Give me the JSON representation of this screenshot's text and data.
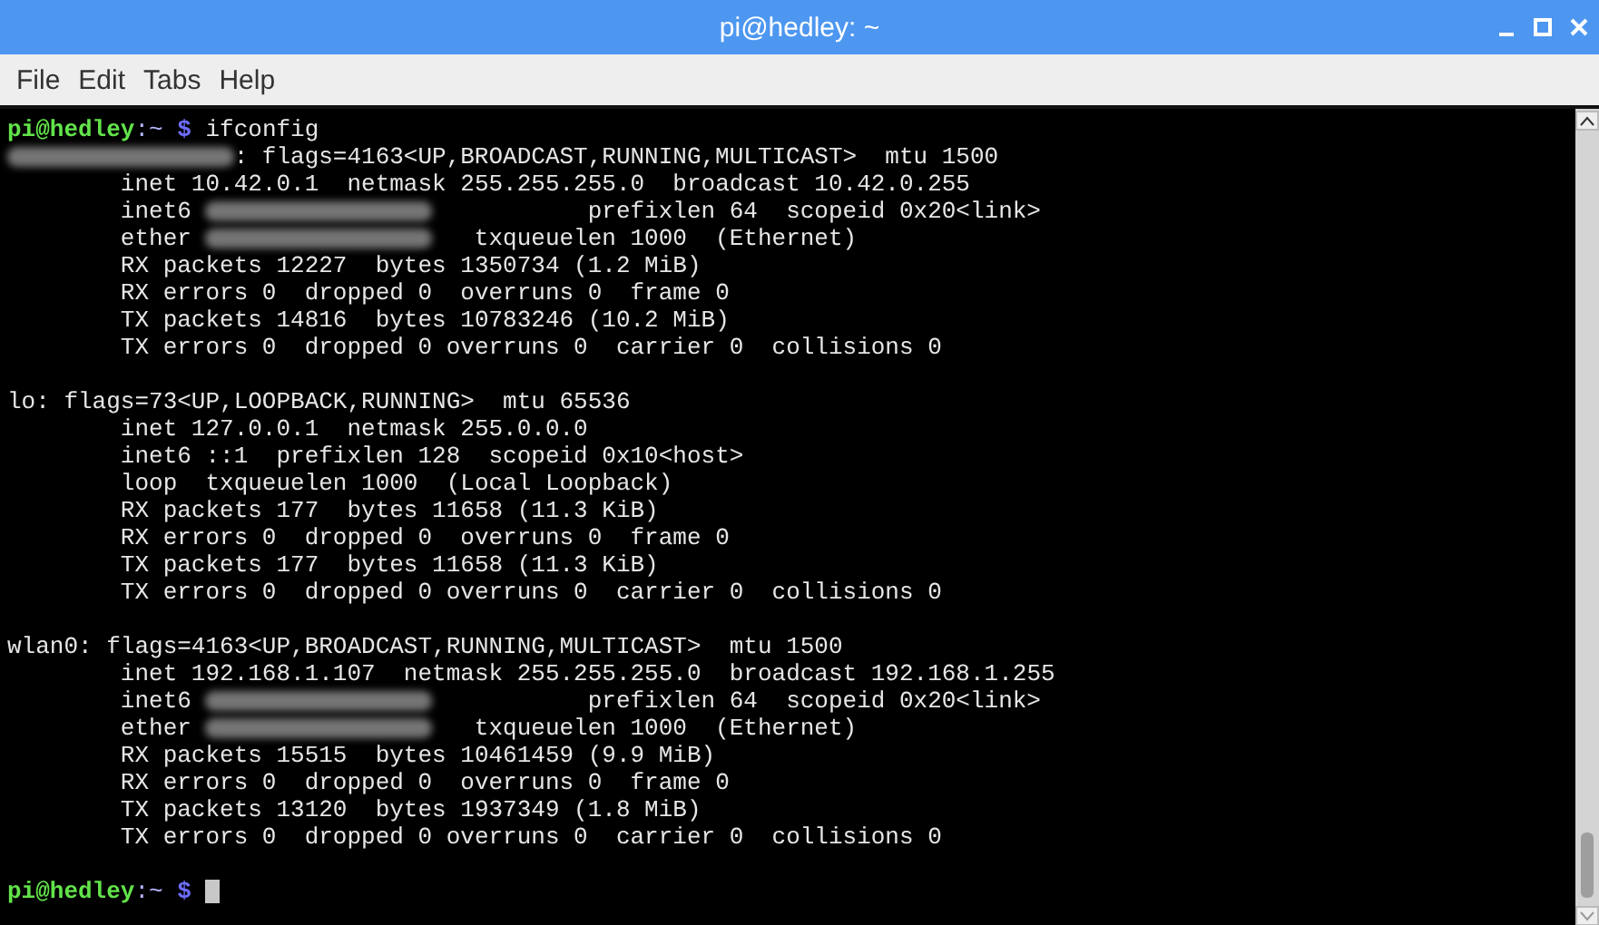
{
  "window": {
    "title": "pi@hedley: ~"
  },
  "menu": [
    "File",
    "Edit",
    "Tabs",
    "Help"
  ],
  "terminal": {
    "lines": [
      {
        "segments": [
          {
            "kind": "user",
            "text": "pi@hedley"
          },
          {
            "kind": "path",
            "text": ":~"
          },
          {
            "kind": "symbol",
            "text": " $"
          },
          {
            "kind": "text",
            "text": " ifconfig"
          }
        ]
      },
      {
        "segments": [
          {
            "kind": "redacted"
          },
          {
            "kind": "text",
            "text": ": flags=4163<UP,BROADCAST,RUNNING,MULTICAST>  mtu 1500"
          }
        ]
      },
      {
        "segments": [
          {
            "kind": "text",
            "text": "        inet 10.42.0.1  netmask 255.255.255.0  broadcast 10.42.0.255"
          }
        ]
      },
      {
        "segments": [
          {
            "kind": "text",
            "text": "        inet6 "
          },
          {
            "kind": "redacted"
          },
          {
            "kind": "text",
            "text": "           prefixlen 64  scopeid 0x20<link>"
          }
        ]
      },
      {
        "segments": [
          {
            "kind": "text",
            "text": "        ether "
          },
          {
            "kind": "redacted"
          },
          {
            "kind": "text",
            "text": "   txqueuelen 1000  (Ethernet)"
          }
        ]
      },
      {
        "segments": [
          {
            "kind": "text",
            "text": "        RX packets 12227  bytes 1350734 (1.2 MiB)"
          }
        ]
      },
      {
        "segments": [
          {
            "kind": "text",
            "text": "        RX errors 0  dropped 0  overruns 0  frame 0"
          }
        ]
      },
      {
        "segments": [
          {
            "kind": "text",
            "text": "        TX packets 14816  bytes 10783246 (10.2 MiB)"
          }
        ]
      },
      {
        "segments": [
          {
            "kind": "text",
            "text": "        TX errors 0  dropped 0 overruns 0  carrier 0  collisions 0"
          }
        ]
      },
      {
        "segments": [
          {
            "kind": "blank"
          }
        ]
      },
      {
        "segments": [
          {
            "kind": "text",
            "text": "lo: flags=73<UP,LOOPBACK,RUNNING>  mtu 65536"
          }
        ]
      },
      {
        "segments": [
          {
            "kind": "text",
            "text": "        inet 127.0.0.1  netmask 255.0.0.0"
          }
        ]
      },
      {
        "segments": [
          {
            "kind": "text",
            "text": "        inet6 ::1  prefixlen 128  scopeid 0x10<host>"
          }
        ]
      },
      {
        "segments": [
          {
            "kind": "text",
            "text": "        loop  txqueuelen 1000  (Local Loopback)"
          }
        ]
      },
      {
        "segments": [
          {
            "kind": "text",
            "text": "        RX packets 177  bytes 11658 (11.3 KiB)"
          }
        ]
      },
      {
        "segments": [
          {
            "kind": "text",
            "text": "        RX errors 0  dropped 0  overruns 0  frame 0"
          }
        ]
      },
      {
        "segments": [
          {
            "kind": "text",
            "text": "        TX packets 177  bytes 11658 (11.3 KiB)"
          }
        ]
      },
      {
        "segments": [
          {
            "kind": "text",
            "text": "        TX errors 0  dropped 0 overruns 0  carrier 0  collisions 0"
          }
        ]
      },
      {
        "segments": [
          {
            "kind": "blank"
          }
        ]
      },
      {
        "segments": [
          {
            "kind": "text",
            "text": "wlan0: flags=4163<UP,BROADCAST,RUNNING,MULTICAST>  mtu 1500"
          }
        ]
      },
      {
        "segments": [
          {
            "kind": "text",
            "text": "        inet 192.168.1.107  netmask 255.255.255.0  broadcast 192.168.1.255"
          }
        ]
      },
      {
        "segments": [
          {
            "kind": "text",
            "text": "        inet6 "
          },
          {
            "kind": "redacted"
          },
          {
            "kind": "text",
            "text": "           prefixlen 64  scopeid 0x20<link>"
          }
        ]
      },
      {
        "segments": [
          {
            "kind": "text",
            "text": "        ether "
          },
          {
            "kind": "redacted"
          },
          {
            "kind": "text",
            "text": "   txqueuelen 1000  (Ethernet)"
          }
        ]
      },
      {
        "segments": [
          {
            "kind": "text",
            "text": "        RX packets 15515  bytes 10461459 (9.9 MiB)"
          }
        ]
      },
      {
        "segments": [
          {
            "kind": "text",
            "text": "        RX errors 0  dropped 0  overruns 0  frame 0"
          }
        ]
      },
      {
        "segments": [
          {
            "kind": "text",
            "text": "        TX packets 13120  bytes 1937349 (1.8 MiB)"
          }
        ]
      },
      {
        "segments": [
          {
            "kind": "text",
            "text": "        TX errors 0  dropped 0 overruns 0  carrier 0  collisions 0"
          }
        ]
      },
      {
        "segments": [
          {
            "kind": "blank"
          }
        ]
      },
      {
        "segments": [
          {
            "kind": "user",
            "text": "pi@hedley"
          },
          {
            "kind": "path",
            "text": ":~"
          },
          {
            "kind": "symbol",
            "text": " $"
          },
          {
            "kind": "cursor"
          }
        ]
      }
    ]
  }
}
